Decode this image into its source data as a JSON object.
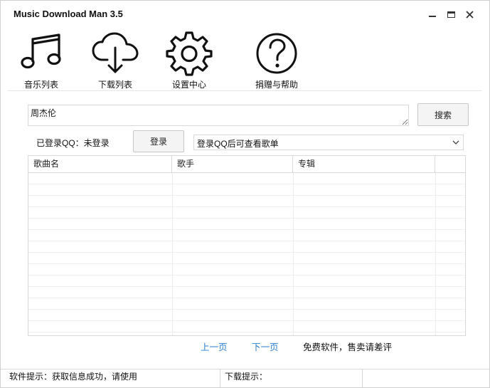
{
  "window": {
    "title": "Music Download Man 3.5"
  },
  "toolbar": {
    "music_list": "音乐列表",
    "download_list": "下载列表",
    "settings": "设置中心",
    "help": "捐赠与帮助"
  },
  "search": {
    "value": "周杰伦",
    "button": "搜索"
  },
  "login": {
    "status": "已登录QQ：未登录",
    "button": "登录"
  },
  "playlist_select": {
    "selected": "登录QQ后可查看歌单"
  },
  "table": {
    "columns": [
      "歌曲名",
      "歌手",
      "专辑"
    ],
    "rows": []
  },
  "pagination": {
    "prev": "上一页",
    "next": "下一页",
    "notice": "免费软件，售卖请差评"
  },
  "statusbar": {
    "software_tip": "软件提示：获取信息成功，请使用",
    "download_tip": "下载提示："
  },
  "colors": {
    "link": "#2a7fd0",
    "border": "#d9d9d9"
  }
}
